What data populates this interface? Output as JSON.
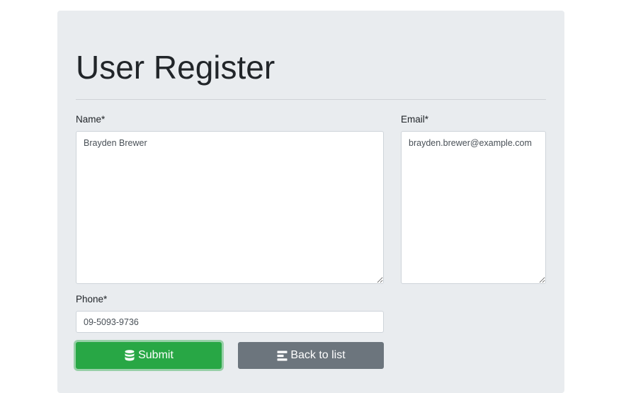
{
  "page": {
    "title": "User Register"
  },
  "form": {
    "name": {
      "label": "Name*",
      "value": "Brayden Brewer"
    },
    "email": {
      "label": "Email*",
      "value": "brayden.brewer@example.com"
    },
    "phone": {
      "label": "Phone*",
      "value": "09-5093-9736"
    }
  },
  "actions": {
    "submit_label": "Submit",
    "submit_icon": "database-icon",
    "back_label": "Back to list",
    "back_icon": "list-icon"
  },
  "colors": {
    "panel_background": "#e9ecef",
    "submit": "#28a745",
    "back": "#6c757d"
  }
}
